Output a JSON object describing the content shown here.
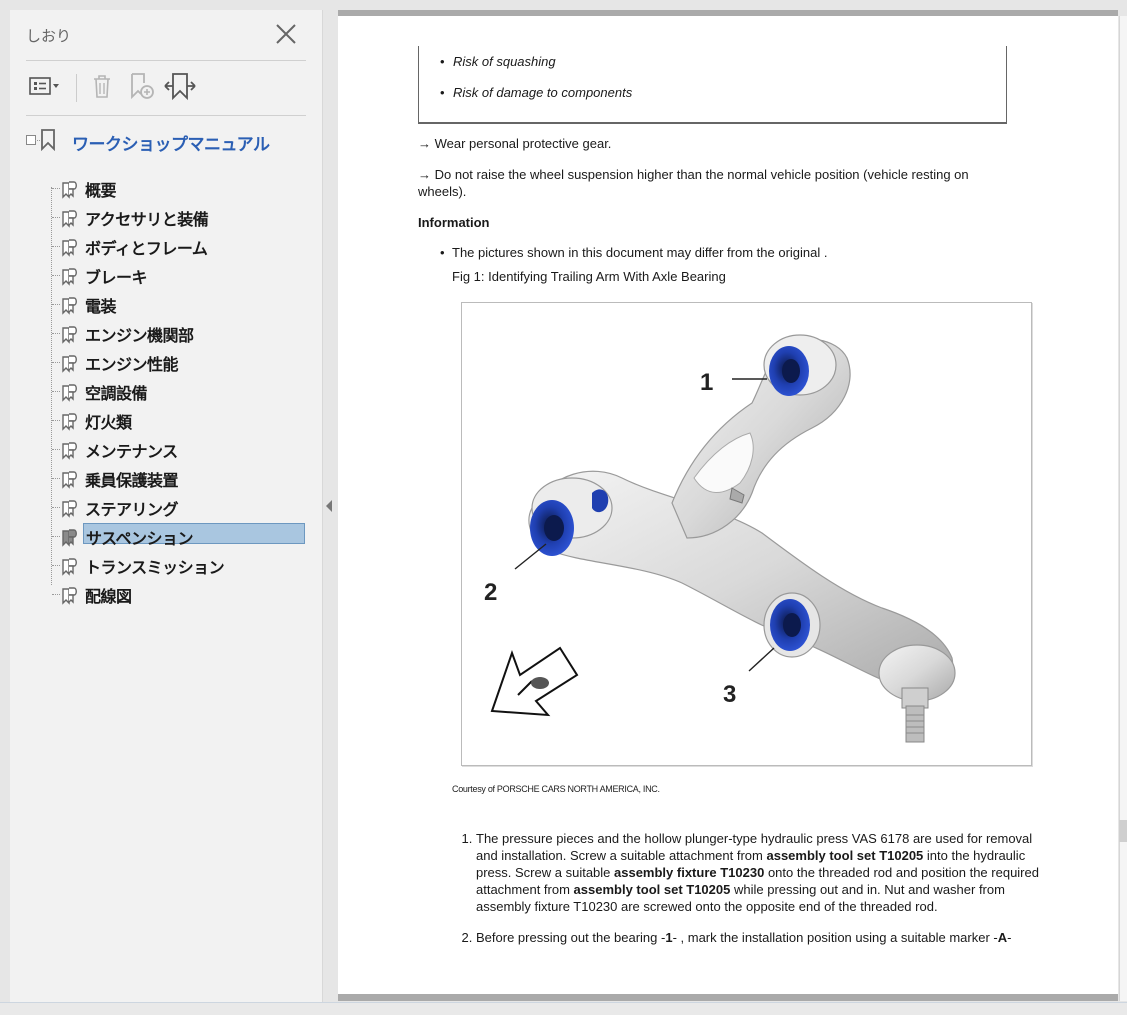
{
  "sidebar": {
    "title": "しおり",
    "root": {
      "label": "ワークショップマニュアル"
    },
    "items": [
      {
        "label": "概要"
      },
      {
        "label": "アクセサリと装備"
      },
      {
        "label": "ボディとフレーム"
      },
      {
        "label": "ブレーキ"
      },
      {
        "label": "電装"
      },
      {
        "label": "エンジン機関部"
      },
      {
        "label": "エンジン性能"
      },
      {
        "label": "空調設備"
      },
      {
        "label": "灯火類"
      },
      {
        "label": "メンテナンス"
      },
      {
        "label": "乗員保護装置"
      },
      {
        "label": "ステアリング"
      },
      {
        "label": "サスペンション",
        "selected": true
      },
      {
        "label": "トランスミッション"
      },
      {
        "label": "配線図"
      }
    ],
    "toolbar": {
      "icons": [
        "options-menu-icon",
        "delete-icon",
        "new-bookmark-icon",
        "expand-bookmark-icon"
      ]
    }
  },
  "document": {
    "warning_items": [
      "Risk of squashing",
      "Risk of damage to components"
    ],
    "para1": "→ Wear personal protective gear.",
    "para2": "→ Do not raise the wheel suspension higher than the normal vehicle position (vehicle resting on wheels).",
    "info_heading": "Information",
    "info_bullet": "The pictures shown in this document may differ from the original  .",
    "fig_caption": "Fig 1: Identifying Trailing Arm With Axle Bearing",
    "figure_labels": [
      "1",
      "2",
      "3"
    ],
    "courtesy": "Courtesy of PORSCHE CARS NORTH AMERICA, INC.",
    "steps": [
      {
        "t1": "The pressure pieces and the hollow plunger-type hydraulic press VAS 6178 are used for removal and installation. Screw a suitable attachment from ",
        "b1": "assembly tool set T10205",
        "t2": "  into the hydraulic press. Screw a suitable ",
        "b2": "assembly fixture T10230",
        "t3": "  onto the threaded rod and position the required attachment from ",
        "b3": "assembly tool set T10205",
        "t4": "  while pressing out and in. Nut and washer from assembly fixture T10230 are screwed onto the opposite end of the threaded rod."
      },
      {
        "t1": "Before pressing out the bearing -",
        "b1": "1",
        "t2": "-  , mark the installation position using a suitable marker -",
        "b2": "A",
        "t3": "-"
      }
    ]
  },
  "colors": {
    "accent_link": "#2b5fb4",
    "selection": "#a9c6e0",
    "bushing_blue": "#1f3fb0"
  }
}
